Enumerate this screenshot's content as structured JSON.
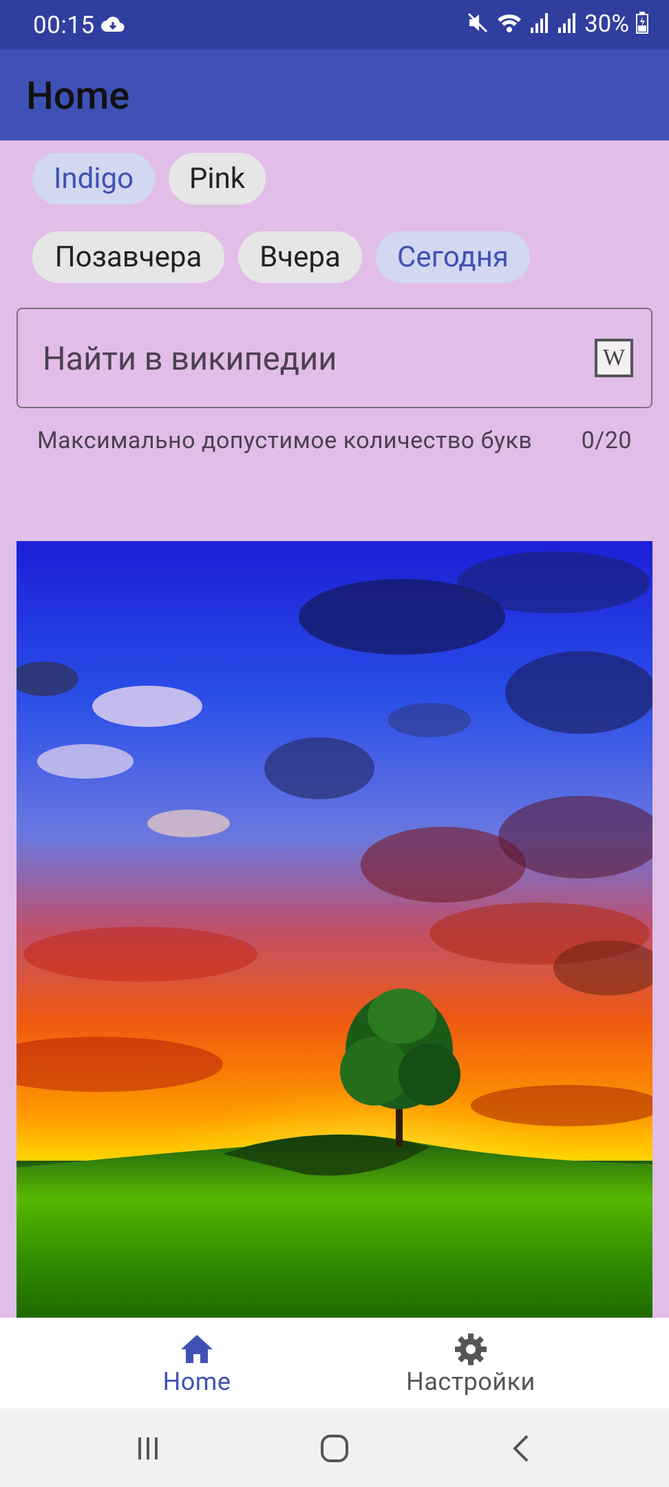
{
  "status_bar": {
    "time": "00:15",
    "battery": "30%"
  },
  "app_bar": {
    "title": "Home"
  },
  "theme_chips": [
    {
      "label": "Indigo",
      "selected": true
    },
    {
      "label": "Pink",
      "selected": false
    }
  ],
  "day_chips": [
    {
      "label": "Позавчера",
      "selected": false
    },
    {
      "label": "Вчера",
      "selected": false
    },
    {
      "label": "Сегодня",
      "selected": true
    }
  ],
  "search": {
    "placeholder": "Найти в википедии",
    "value": "",
    "end_icon_text": "W",
    "helper": "Максимально допустимое количество букв",
    "counter": "0/20"
  },
  "bottom_nav": [
    {
      "label": "Home",
      "icon": "home-icon",
      "active": true
    },
    {
      "label": "Настройки",
      "icon": "gear-icon",
      "active": false
    }
  ],
  "colors": {
    "status_bar": "#303f9f",
    "app_bar": "#3f51b5",
    "background": "#e1bee7",
    "active_nav": "#3f51b5",
    "inactive_nav": "#555555"
  }
}
